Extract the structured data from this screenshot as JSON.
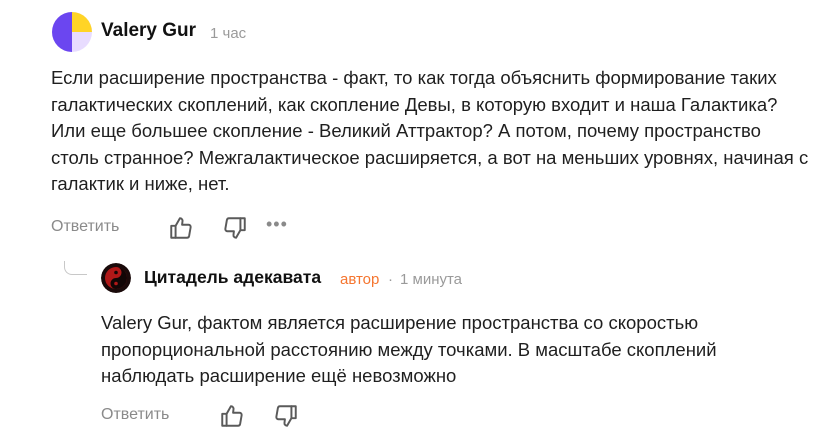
{
  "comment": {
    "author": "Valery Gur",
    "time": "1 час",
    "text": "Если расширение пространства - факт, то как тогда объяснить формирование таких галактических скоплений, как скопление Девы, в которую входит и наша Галактика? Или еще большее скопление - Великий Аттрактор? А потом, почему пространство столь странное? Межгалактическое расширяется, а вот на меньших уровнях, начиная с галактик и ниже, нет.",
    "reply_label": "Ответить",
    "more_label": "•••",
    "avatar_colors": [
      "#6b46f0",
      "#ffd426",
      "#e8dcff"
    ]
  },
  "reply": {
    "author": "Цитадель адекавата",
    "badge": "автор",
    "separator": "·",
    "time": "1 минута",
    "text": "Valery Gur, фактом является расширение пространства со скоростью пропорциональной расстоянию между точками. В масштабе скоплений наблюдать расширение ещё невозможно",
    "reply_label": "Ответить",
    "accent_color": "#f5752f"
  }
}
